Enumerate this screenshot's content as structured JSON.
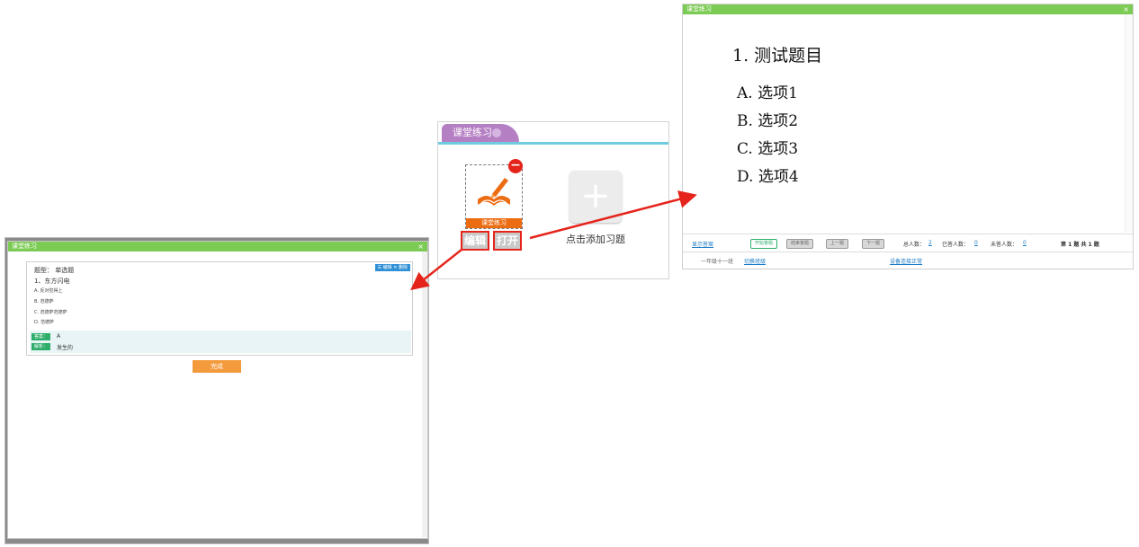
{
  "left_dialog": {
    "title": "课堂练习",
    "close": "×",
    "question_type": "题型： 单选题",
    "tools": "☰ 编辑  ✕ 删除",
    "question": "1、东方闪电",
    "options": [
      "A. 反对犯得上",
      "B. 范德萨",
      "C. 范德萨范德萨",
      "D. 范德萨"
    ],
    "answer_tag": "答案：",
    "answer_value": "A",
    "analysis_tag": "解析：",
    "analysis_value": "发生的",
    "done_button": "完成"
  },
  "middle_widget": {
    "tab_label": "课堂练习",
    "card_label": "课堂练习",
    "remove_icon": "−",
    "edit_button": "编辑",
    "open_button": "打开",
    "plus_icon": "+",
    "add_text": "点击添加习题"
  },
  "right_window": {
    "title": "课堂练习",
    "close": "×",
    "question": "1. 测试题目",
    "options": [
      "A. 选项1",
      "B. 选项2",
      "C. 选项3",
      "D. 选项4"
    ],
    "show_answer": "显示答案",
    "start_answer": "开始答题",
    "end_answer": "结束答题",
    "prev": "上一题",
    "next": "下一题",
    "total_label": "总人数：",
    "total_value": "2",
    "answered_label": "已答人数：",
    "answered_value": "0",
    "unanswered_label": "未答人数：",
    "unanswered_value": "0",
    "page_info": "第 1 题  共 1 题",
    "class_name": "一年级十一班",
    "switch_class": "切换班级",
    "device_status": "设备连接正常"
  },
  "colors": {
    "titlebar_green": "#7ccb54",
    "arrow_red": "#e5251c",
    "orange": "#f39a3c",
    "purple_tab": "#b57fc4"
  }
}
